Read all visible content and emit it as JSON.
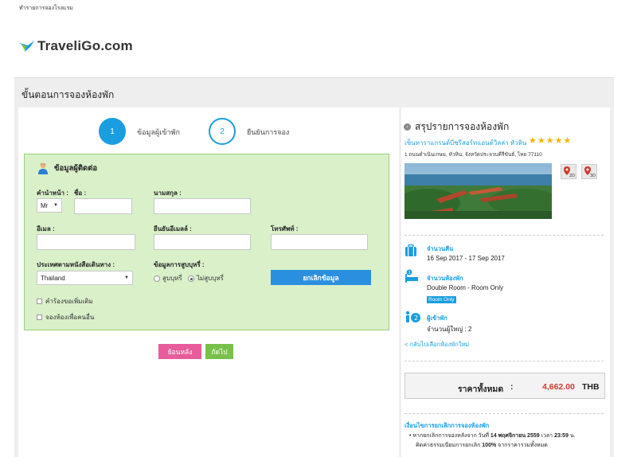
{
  "top_note": "ทำรายการจองโรงแรม",
  "logo": {
    "text_a": "Travel",
    "text_b": "i",
    "text_c": "Go",
    "text_d": ".com"
  },
  "page_title": "ขั้นตอนการจองห้องพัก",
  "steps": [
    {
      "number": "1",
      "label": "ข้อมูลผู้เข้าพัก"
    },
    {
      "number": "2",
      "label": "ยืนยันการจอง"
    }
  ],
  "contact": {
    "title": "ข้อมูลผู้ติดต่อ",
    "prefix_label": "คำนำหน้า :",
    "prefix_value": "Mr",
    "firstname_label": "ชื่อ :",
    "lastname_label": "นามสกุล :",
    "email_label": "อีเมล :",
    "email_confirm_label": "ยืนยันอีเมลล์ :",
    "phone_label": "โทรศัพท์ :",
    "country_label": "ประเทศตามหนังสือเดินทาง :",
    "country_value": "Thailand",
    "smoking_label": "ข้อมูลการสูบบุหรี่ :",
    "smoking_options": [
      "สูบบุหรี่",
      "ไม่สูบบุหรี่"
    ],
    "smoking_selected": 1,
    "clear_button": "ยกเลิกข้อมูล",
    "extra_request": "คำร้องขอเพิ่มเติม",
    "book_for_other": "จองห้องเพื่อคนอื่น"
  },
  "buttons": {
    "back": "ย้อนหลัง",
    "next": "ถัดไป"
  },
  "summary": {
    "title": "สรุปรายการจองห้องพัก",
    "hotel_name": "เซ็นทาราแกรนด์บีชรีสอร์ทแอนด์วิลล่า หัวหิน",
    "stars": "★★★★★",
    "address": "1 ถนนดำเนินเกษม, หัวหิน, จังหวัดประจวบคีรีขันธ์, ไทย 77110",
    "nights_label": "จำนวนคืน",
    "nights_value": "16 Sep 2017 - 17 Sep 2017",
    "rooms_label": "จำนวนห้องพัก",
    "rooms_value": "Double Room - Room Only",
    "rooms_badge": "Room Only",
    "guests_label": "ผู้เข้าพัก",
    "guests_value": "จำนวนผู้ใหญ่ : 2",
    "back_link": "< กลับไปเลือกห้องพักใหม่",
    "total_label": "ราคาทั้งหมด",
    "total_colon": ":",
    "total_amount": "4,662.00",
    "total_currency": "THB",
    "map_2d": "2D",
    "map_3d": "3D",
    "cancel_title": "เงื่อนไขการยกเลิกการจองห้องพัก",
    "cancel_line1_a": "หากยกเลิกการจองหลังจาก วันที่ ",
    "cancel_line1_b": "14 พฤศจิกายน 2559",
    "cancel_line1_c": " เวลา ",
    "cancel_line1_d": "23:59",
    "cancel_line1_e": " น.",
    "cancel_line2_a": "คิดค่าธรรมเนียมการยกเลิก ",
    "cancel_line2_b": "100%",
    "cancel_line2_c": " จากราคารวมทั้งหมด"
  },
  "colors": {
    "accent": "#1a9ee0",
    "contact_bg": "#d9f0c9",
    "back_btn": "#e85c9b",
    "next_btn": "#79c04a",
    "price": "#d43a2e"
  }
}
